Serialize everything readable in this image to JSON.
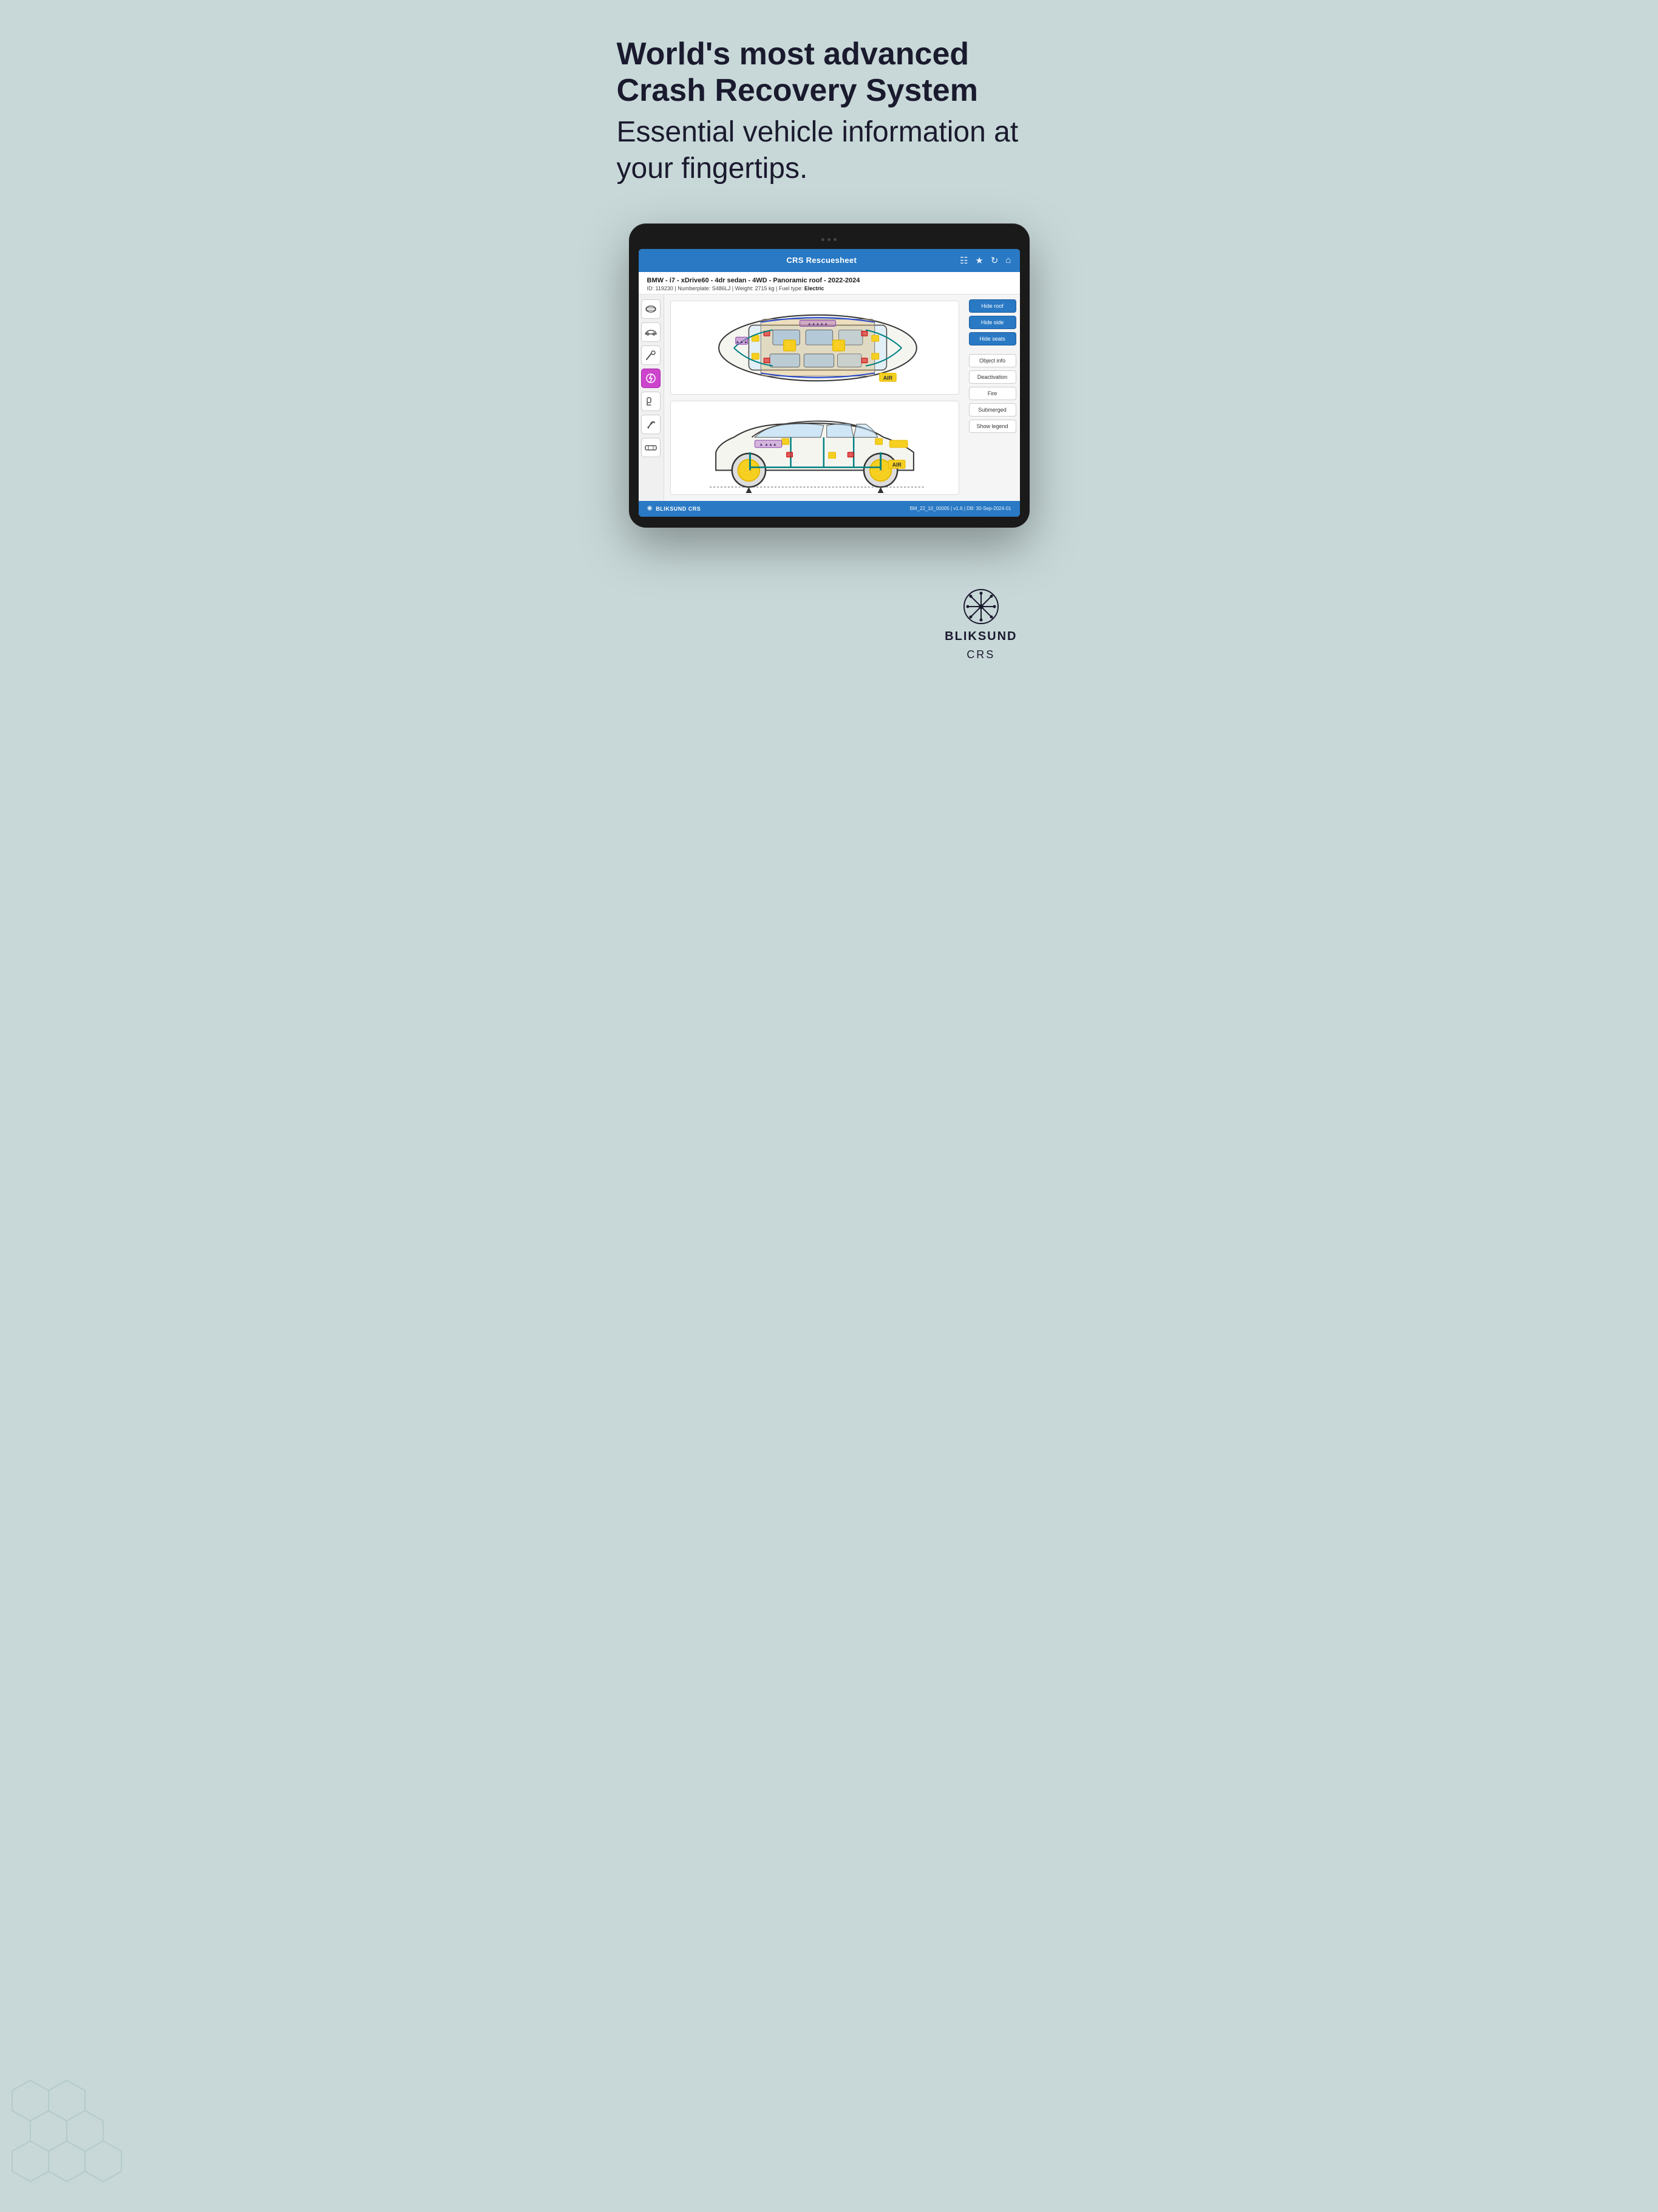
{
  "page": {
    "background_color": "#c8d8d8"
  },
  "headline": {
    "line1": "World's most advanced",
    "line2": "Crash Recovery System",
    "subline": "Essential vehicle information at your fingertips."
  },
  "app": {
    "title": "CRS Rescuesheet",
    "vehicle": {
      "full_title": "BMW - i7 - xDrive60 - 4dr sedan - 4WD - Panoramic roof - 2022-2024",
      "id": "ID: 119230",
      "numberplate": "Numberplate: S486LJ",
      "weight": "Weight: 2715 kg",
      "fuel_type_label": "Fuel type:",
      "fuel_type_value": "Electric"
    },
    "buttons": {
      "hide_roof": "Hide roof",
      "hide_side": "Hide side",
      "hide_seats": "Hide seats",
      "object_info": "Object info",
      "deactivation": "Deactivation",
      "fire": "Fire",
      "submerged": "Submerged",
      "show_legend": "Show legend"
    },
    "footer": {
      "brand": "BLIKSUND CRS",
      "version_info": "BM_22_10_00005 | v1.6 | DB: 30-Sep-2024-01"
    }
  },
  "bottom_brand": {
    "name": "BLIKSUND",
    "sub": "CRS"
  }
}
